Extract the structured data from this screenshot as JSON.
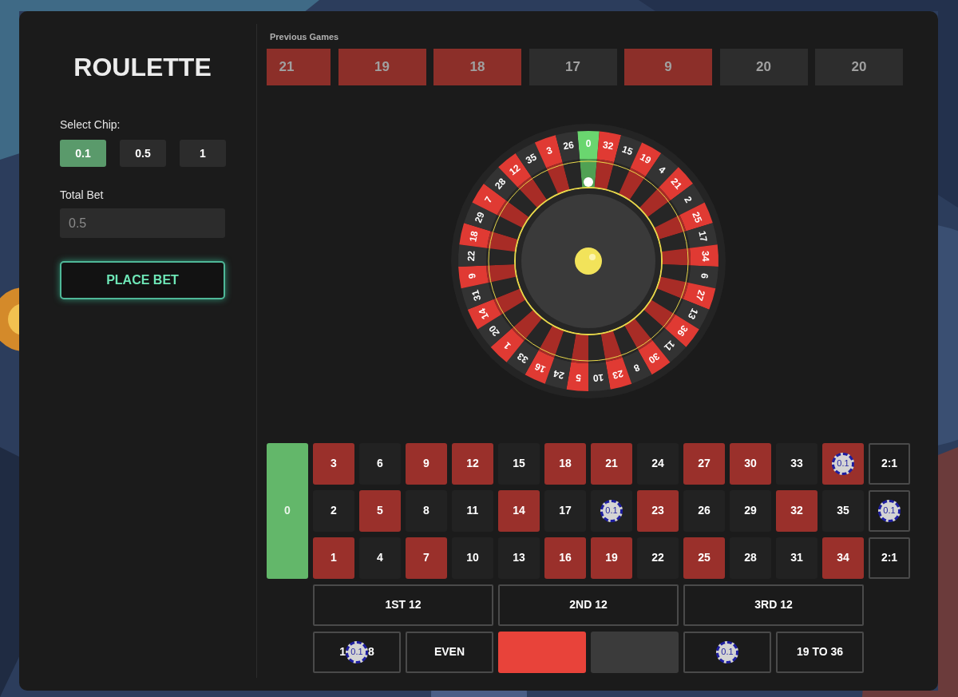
{
  "title": "ROULETTE",
  "chip_select": {
    "label": "Select Chip:",
    "chips": [
      {
        "label": "0.1",
        "selected": true
      },
      {
        "label": "0.5",
        "selected": false
      },
      {
        "label": "1",
        "selected": false
      }
    ]
  },
  "total_bet": {
    "label": "Total Bet",
    "value": "0.5"
  },
  "place_bet": "PLACE BET",
  "previous_games": {
    "label": "Previous Games",
    "results": [
      {
        "label": "21",
        "color": "#8c2f29"
      },
      {
        "label": "19",
        "color": "#8c2f29"
      },
      {
        "label": "18",
        "color": "#8c2f29"
      },
      {
        "label": "17",
        "color": "#2d2d2d"
      },
      {
        "label": "9",
        "color": "#8c2f29"
      },
      {
        "label": "20",
        "color": "#2d2d2d"
      },
      {
        "label": "20",
        "color": "#2d2d2d"
      }
    ]
  },
  "wheel": {
    "pockets": [
      {
        "label": "0",
        "color": "#6ad66f"
      },
      {
        "label": "32",
        "color": "#e03a33"
      },
      {
        "label": "15",
        "color": "#333333"
      },
      {
        "label": "19",
        "color": "#e03a33"
      },
      {
        "label": "4",
        "color": "#333333"
      },
      {
        "label": "21",
        "color": "#e03a33"
      },
      {
        "label": "2",
        "color": "#333333"
      },
      {
        "label": "25",
        "color": "#e03a33"
      },
      {
        "label": "17",
        "color": "#333333"
      },
      {
        "label": "34",
        "color": "#e03a33"
      },
      {
        "label": "6",
        "color": "#333333"
      },
      {
        "label": "27",
        "color": "#e03a33"
      },
      {
        "label": "13",
        "color": "#333333"
      },
      {
        "label": "36",
        "color": "#e03a33"
      },
      {
        "label": "11",
        "color": "#333333"
      },
      {
        "label": "30",
        "color": "#e03a33"
      },
      {
        "label": "8",
        "color": "#333333"
      },
      {
        "label": "23",
        "color": "#e03a33"
      },
      {
        "label": "10",
        "color": "#333333"
      },
      {
        "label": "5",
        "color": "#e03a33"
      },
      {
        "label": "24",
        "color": "#333333"
      },
      {
        "label": "16",
        "color": "#e03a33"
      },
      {
        "label": "33",
        "color": "#333333"
      },
      {
        "label": "1",
        "color": "#e03a33"
      },
      {
        "label": "20",
        "color": "#333333"
      },
      {
        "label": "14",
        "color": "#e03a33"
      },
      {
        "label": "31",
        "color": "#333333"
      },
      {
        "label": "9",
        "color": "#e03a33"
      },
      {
        "label": "22",
        "color": "#333333"
      },
      {
        "label": "18",
        "color": "#e03a33"
      },
      {
        "label": "29",
        "color": "#333333"
      },
      {
        "label": "7",
        "color": "#e03a33"
      },
      {
        "label": "28",
        "color": "#333333"
      },
      {
        "label": "12",
        "color": "#e03a33"
      },
      {
        "label": "35",
        "color": "#333333"
      },
      {
        "label": "3",
        "color": "#e03a33"
      },
      {
        "label": "26",
        "color": "#333333"
      }
    ]
  },
  "table": {
    "zero": {
      "label": "0",
      "color": "#63b76a"
    },
    "rows": [
      [
        {
          "label": "3",
          "color": "#9a302b"
        },
        {
          "label": "6",
          "color": "#222222"
        },
        {
          "label": "9",
          "color": "#9a302b"
        },
        {
          "label": "12",
          "color": "#9a302b"
        },
        {
          "label": "15",
          "color": "#222222"
        },
        {
          "label": "18",
          "color": "#9a302b"
        },
        {
          "label": "21",
          "color": "#9a302b"
        },
        {
          "label": "24",
          "color": "#222222"
        },
        {
          "label": "27",
          "color": "#9a302b"
        },
        {
          "label": "30",
          "color": "#9a302b"
        },
        {
          "label": "33",
          "color": "#222222"
        },
        {
          "color": "#9a302b",
          "chip": "0.1"
        }
      ],
      [
        {
          "label": "2",
          "color": "#222222"
        },
        {
          "label": "5",
          "color": "#9a302b"
        },
        {
          "label": "8",
          "color": "#222222"
        },
        {
          "label": "11",
          "color": "#222222"
        },
        {
          "label": "14",
          "color": "#9a302b"
        },
        {
          "label": "17",
          "color": "#222222"
        },
        {
          "color": "#222222",
          "chip": "0.1"
        },
        {
          "label": "23",
          "color": "#9a302b"
        },
        {
          "label": "26",
          "color": "#222222"
        },
        {
          "label": "29",
          "color": "#222222"
        },
        {
          "label": "32",
          "color": "#9a302b"
        },
        {
          "label": "35",
          "color": "#222222"
        }
      ],
      [
        {
          "label": "1",
          "color": "#9a302b"
        },
        {
          "label": "4",
          "color": "#222222"
        },
        {
          "label": "7",
          "color": "#9a302b"
        },
        {
          "label": "10",
          "color": "#222222"
        },
        {
          "label": "13",
          "color": "#222222"
        },
        {
          "label": "16",
          "color": "#9a302b"
        },
        {
          "label": "19",
          "color": "#9a302b"
        },
        {
          "label": "22",
          "color": "#222222"
        },
        {
          "label": "25",
          "color": "#9a302b"
        },
        {
          "label": "28",
          "color": "#222222"
        },
        {
          "label": "31",
          "color": "#222222"
        },
        {
          "label": "34",
          "color": "#9a302b"
        }
      ]
    ],
    "column_bets": [
      {
        "label": "2:1"
      },
      {
        "chip": "0.1"
      },
      {
        "label": "2:1"
      }
    ],
    "dozens": [
      {
        "label": "1ST 12"
      },
      {
        "label": "2ND 12"
      },
      {
        "label": "3RD 12"
      }
    ],
    "outside": [
      {
        "kind": "text",
        "label_parts": [
          "1",
          "8"
        ],
        "chip": "0.1"
      },
      {
        "kind": "text",
        "label": "EVEN"
      },
      {
        "kind": "color",
        "color": "#e8433a"
      },
      {
        "kind": "color",
        "color": "#3b3b3b"
      },
      {
        "kind": "text",
        "chip": "0.1"
      },
      {
        "kind": "text",
        "label": "19 TO 36"
      }
    ]
  }
}
